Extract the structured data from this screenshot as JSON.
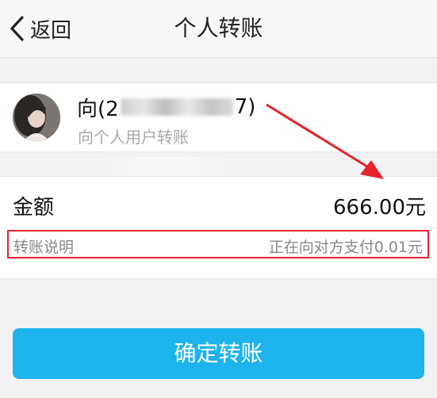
{
  "navbar": {
    "back_label": "返回",
    "title": "个人转账"
  },
  "recipient": {
    "name_prefix": "向(2",
    "name_suffix": "7)",
    "subtitle": "向个人用户转账"
  },
  "amount": {
    "label": "金额",
    "value": "666.00元"
  },
  "note": {
    "label": "转账说明",
    "value": "正在向对方支付0.01元"
  },
  "confirm_label": "确定转账",
  "colors": {
    "accent": "#1db3ec",
    "highlight_box": "#e8232b",
    "arrow": "#e8232b"
  }
}
